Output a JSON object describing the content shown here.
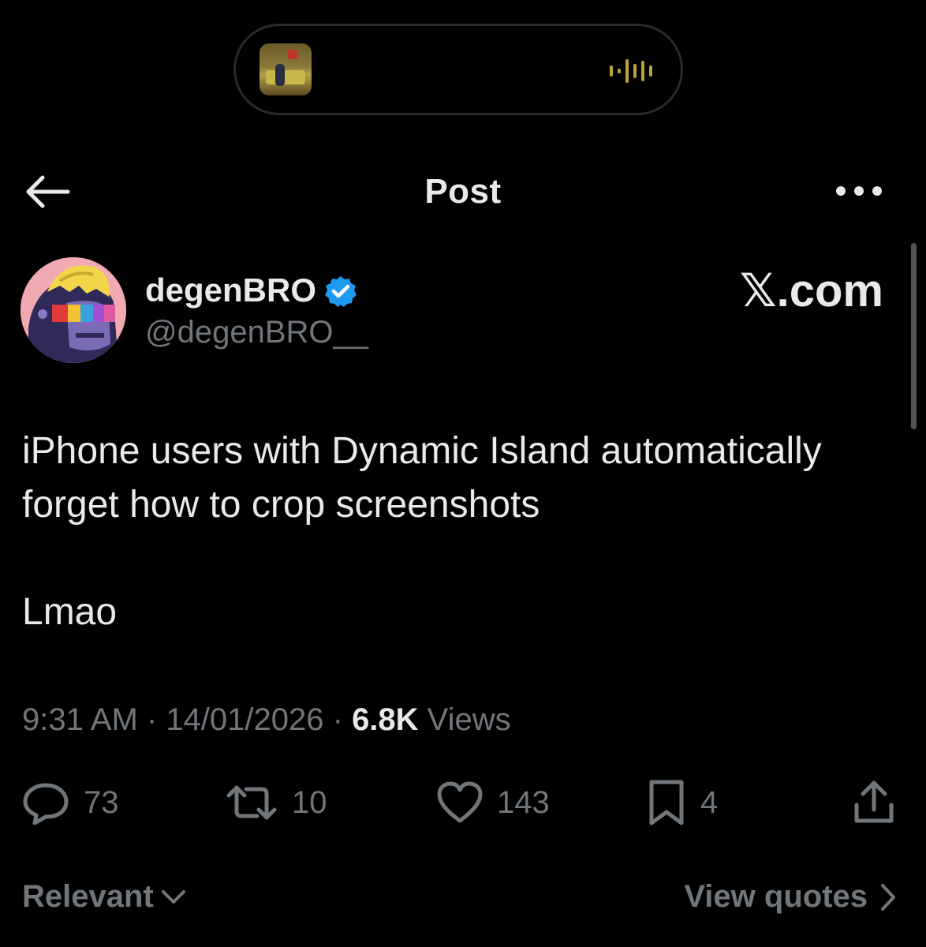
{
  "island": {
    "album_icon": "album-art-thumbnail",
    "waveform_icon": "audio-waveform-icon",
    "accent_color": "#b8a43a"
  },
  "header": {
    "title": "Post",
    "back_icon": "back-arrow-icon",
    "more_icon": "more-horizontal-icon"
  },
  "author": {
    "display_name": "degenBRO",
    "handle": "@degenBRO__",
    "verified_icon": "verified-badge-icon",
    "verified_color": "#1d9bf0",
    "avatar_icon": "avatar-pixel-ape"
  },
  "watermark": "𝕏.com",
  "post": {
    "line1": "iPhone users with Dynamic Island automatically forget how to crop screenshots",
    "line2": "Lmao"
  },
  "meta": {
    "time": "9:31 AM",
    "separator1": " · ",
    "date": "14/01/2026",
    "separator2": " · ",
    "views_count": "6.8K",
    "views_label": " Views"
  },
  "actions": {
    "replies": {
      "icon": "reply-icon",
      "count": "73"
    },
    "reposts": {
      "icon": "repost-icon",
      "count": "10"
    },
    "likes": {
      "icon": "heart-icon",
      "count": "143"
    },
    "bookmarks": {
      "icon": "bookmark-icon",
      "count": "4"
    },
    "share": {
      "icon": "share-icon"
    }
  },
  "footer": {
    "sort_label": "Relevant",
    "sort_icon": "chevron-down-icon",
    "quotes_label": "View quotes",
    "quotes_icon": "chevron-right-icon"
  },
  "colors": {
    "background": "#000000",
    "text_primary": "#e7e9ea",
    "text_secondary": "#71767b"
  }
}
